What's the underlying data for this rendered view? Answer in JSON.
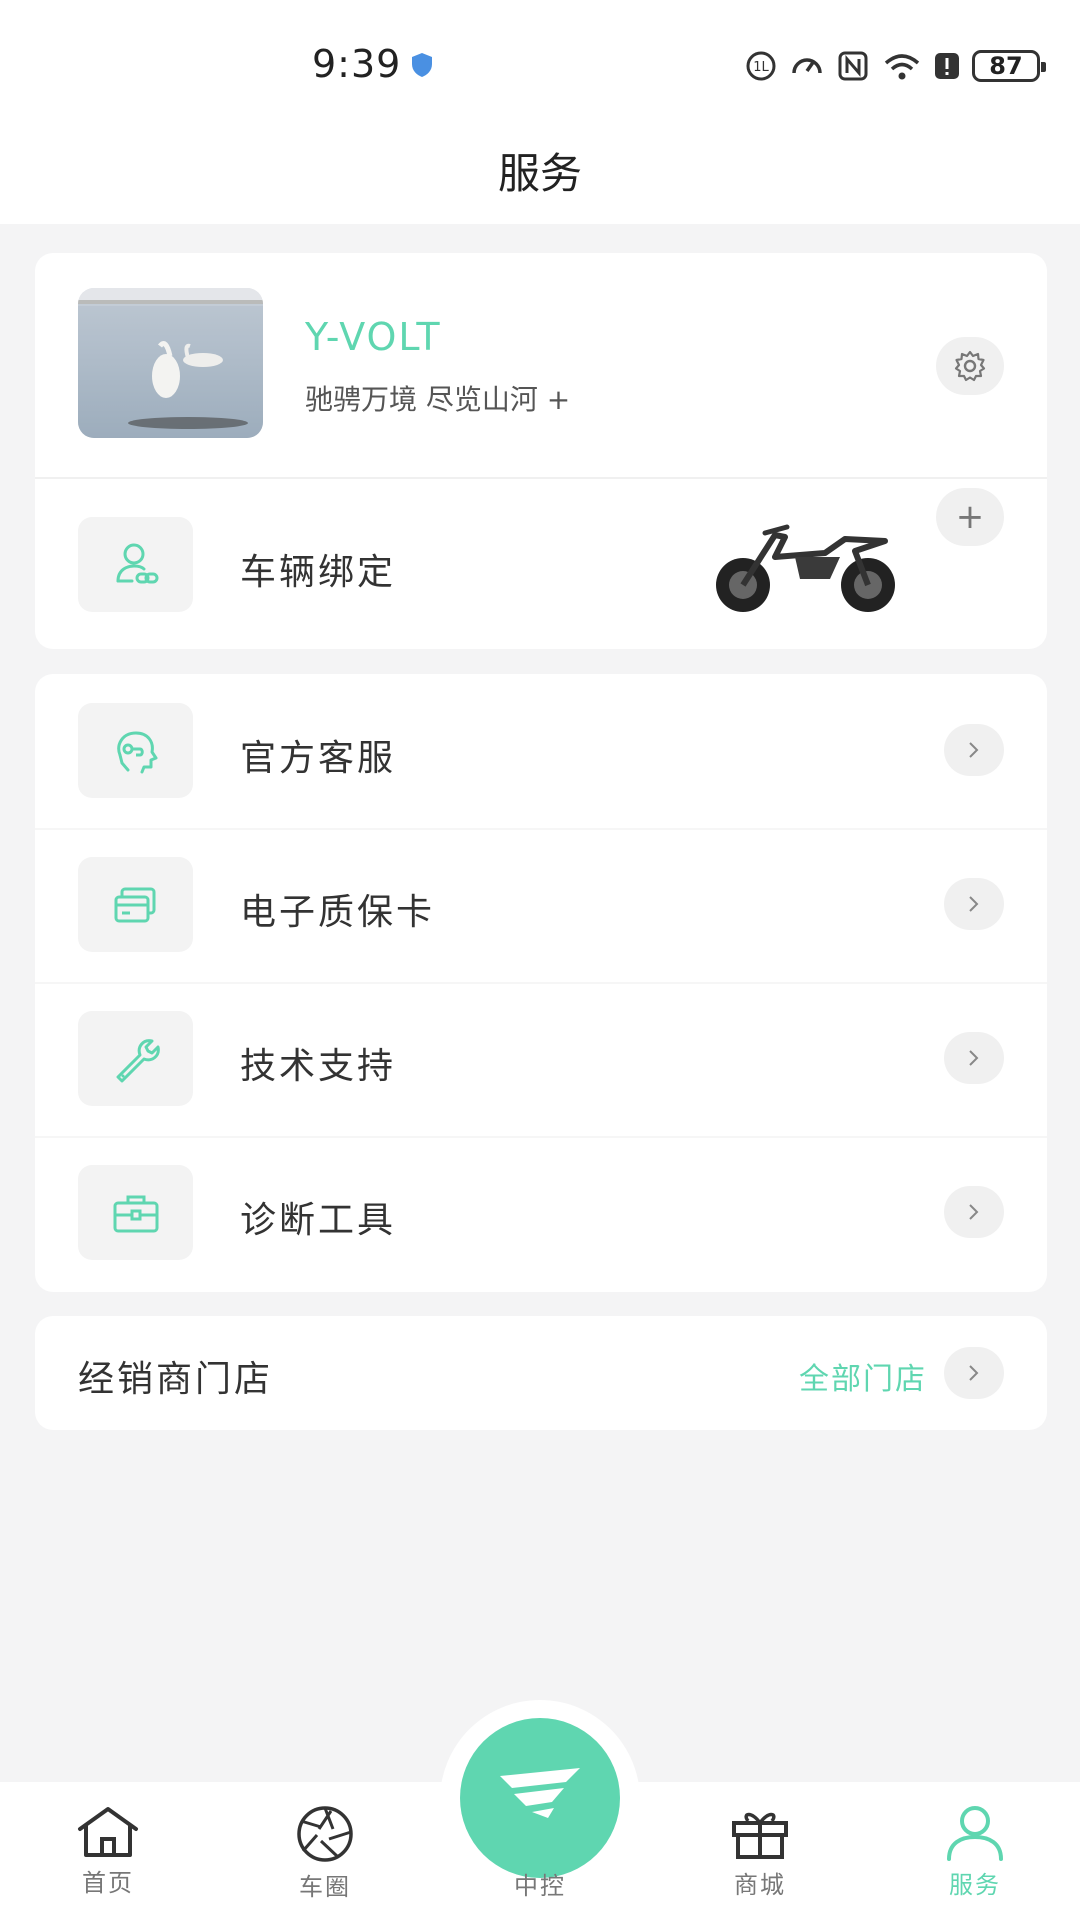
{
  "status_bar": {
    "time": "9:39",
    "battery": "87"
  },
  "header": {
    "title": "服务"
  },
  "profile": {
    "name": "Y-VOLT",
    "slogan": "驰骋万境 尽览山河 +"
  },
  "vehicle": {
    "label": "车辆绑定",
    "add_symbol": "+"
  },
  "services": [
    {
      "label": "官方客服",
      "icon": "headset-support-icon"
    },
    {
      "label": "电子质保卡",
      "icon": "card-icon"
    },
    {
      "label": "技术支持",
      "icon": "wrench-icon"
    },
    {
      "label": "诊断工具",
      "icon": "toolbox-icon"
    }
  ],
  "dealer": {
    "label": "经销商门店",
    "link": "全部门店"
  },
  "tabs": [
    {
      "label": "首页",
      "icon": "home-icon"
    },
    {
      "label": "车圈",
      "icon": "aperture-icon"
    },
    {
      "label": "中控",
      "icon": "logo-icon"
    },
    {
      "label": "商城",
      "icon": "gift-icon"
    },
    {
      "label": "服务",
      "icon": "person-icon",
      "active": true
    }
  ],
  "colors": {
    "accent": "#5fd6b0",
    "background": "#f4f4f5"
  }
}
